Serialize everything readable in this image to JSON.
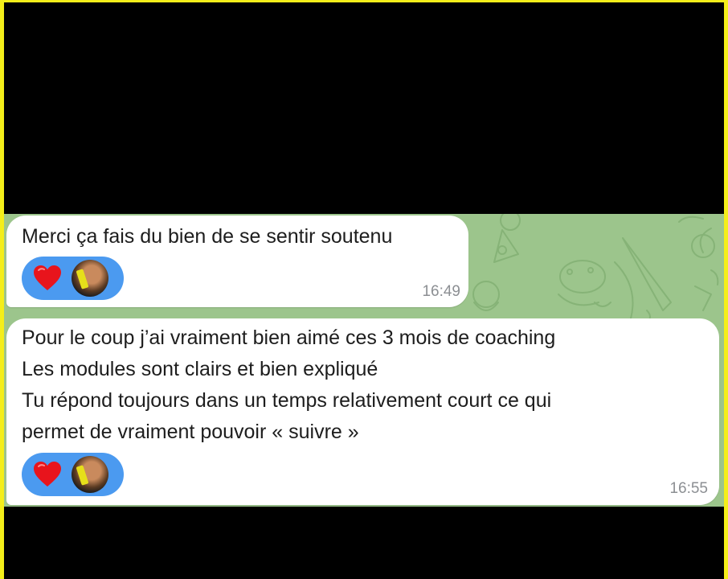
{
  "colors": {
    "frame": "#f4ee1a",
    "chat_background": "#9cc58c",
    "bubble": "#ffffff",
    "reaction_pill": "#4b9af0",
    "heart": "#e8141c",
    "timestamp": "#8c8f93"
  },
  "messages": [
    {
      "text": "Merci ça fais du bien de se sentir soutenu",
      "reactions": [
        "heart-icon",
        "avatar"
      ],
      "time": "16:49"
    },
    {
      "text": "Pour le coup j’ai vraiment bien aimé ces 3 mois de coaching\nLes modules sont clairs et bien expliqué\nTu répond toujours dans un temps relativement court ce qui\npermet de vraiment pouvoir « suivre »",
      "reactions": [
        "heart-icon",
        "avatar"
      ],
      "time": "16:55"
    }
  ]
}
